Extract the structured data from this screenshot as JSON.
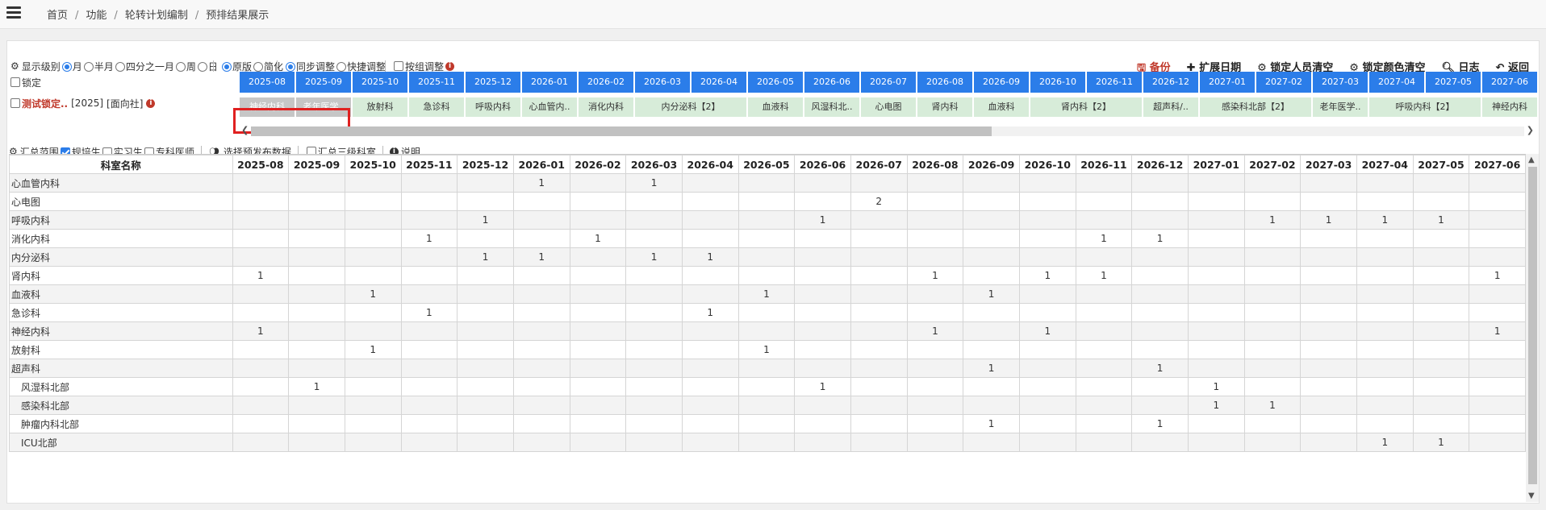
{
  "breadcrumb": [
    "首页",
    "功能",
    "轮转计划编制",
    "预排结果展示"
  ],
  "toolbar": {
    "display_level_label": "显示级别",
    "level_options": [
      {
        "label": "月",
        "selected": true
      },
      {
        "label": "半月",
        "selected": false
      },
      {
        "label": "四分之一月",
        "selected": false
      },
      {
        "label": "周",
        "selected": false
      },
      {
        "label": "日",
        "selected": false
      }
    ],
    "version_options": [
      {
        "label": "原版",
        "selected": true
      },
      {
        "label": "简化",
        "selected": false
      }
    ],
    "adjust_options": [
      {
        "label": "同步调整",
        "selected": true
      },
      {
        "label": "快捷调整",
        "selected": false
      }
    ],
    "group_adjust_label": "按组调整",
    "actions": {
      "backup": "备份",
      "extend_date": "扩展日期",
      "clear_locked_people": "锁定人员清空",
      "clear_locked_colors": "锁定颜色清空",
      "log": "日志",
      "back": "返回"
    }
  },
  "lock": {
    "lock_label": "锁定",
    "person_label": "测试锁定..",
    "person_year": "[2025]",
    "person_tag": "[面向社]"
  },
  "months": [
    "2025-08",
    "2025-09",
    "2025-10",
    "2025-11",
    "2025-12",
    "2026-01",
    "2026-02",
    "2026-03",
    "2026-04",
    "2026-05",
    "2026-06",
    "2026-07",
    "2026-08",
    "2026-09",
    "2026-10",
    "2026-11",
    "2026-12",
    "2027-01",
    "2027-02",
    "2027-03",
    "2027-04",
    "2027-05",
    "2027-06"
  ],
  "assignments": [
    {
      "label": "神经内科",
      "span": 1,
      "locked": true
    },
    {
      "label": "老年医学..",
      "span": 1,
      "locked": true
    },
    {
      "label": "放射科",
      "span": 1,
      "locked": false
    },
    {
      "label": "急诊科",
      "span": 1,
      "locked": false
    },
    {
      "label": "呼吸内科",
      "span": 1,
      "locked": false
    },
    {
      "label": "心血管内..",
      "span": 1,
      "locked": false
    },
    {
      "label": "消化内科",
      "span": 1,
      "locked": false
    },
    {
      "label": "内分泌科【2】",
      "span": 2,
      "locked": false
    },
    {
      "label": "血液科",
      "span": 1,
      "locked": false
    },
    {
      "label": "风湿科北..",
      "span": 1,
      "locked": false
    },
    {
      "label": "心电图",
      "span": 1,
      "locked": false
    },
    {
      "label": "肾内科",
      "span": 1,
      "locked": false
    },
    {
      "label": "血液科",
      "span": 1,
      "locked": false
    },
    {
      "label": "肾内科【2】",
      "span": 2,
      "locked": false
    },
    {
      "label": "超声科/..",
      "span": 1,
      "locked": false
    },
    {
      "label": "感染科北部【2】",
      "span": 2,
      "locked": false
    },
    {
      "label": "老年医学..",
      "span": 1,
      "locked": false
    },
    {
      "label": "呼吸内科【2】",
      "span": 2,
      "locked": false
    },
    {
      "label": "神经内科",
      "span": 1,
      "locked": false
    }
  ],
  "summary": {
    "range_label": "汇总范围",
    "options": [
      {
        "label": "规培生",
        "checked": true
      },
      {
        "label": "实习生",
        "checked": false
      },
      {
        "label": "专科医师",
        "checked": false
      }
    ],
    "select_publish": "选择预发布数据",
    "level3_label": "汇总三级科室",
    "explain": "说明"
  },
  "table": {
    "header_name": "科室名称",
    "rows": [
      {
        "name": "心血管内科",
        "indent": false,
        "values": [
          "",
          "",
          "",
          "",
          "",
          "1",
          "",
          "1",
          "",
          "",
          "",
          "",
          "",
          "",
          "",
          "",
          "",
          "",
          "",
          "",
          "",
          "",
          ""
        ]
      },
      {
        "name": "心电图",
        "indent": false,
        "values": [
          "",
          "",
          "",
          "",
          "",
          "",
          "",
          "",
          "",
          "",
          "",
          "2",
          "",
          "",
          "",
          "",
          "",
          "",
          "",
          "",
          "",
          "",
          ""
        ]
      },
      {
        "name": "呼吸内科",
        "indent": false,
        "values": [
          "",
          "",
          "",
          "",
          "1",
          "",
          "",
          "",
          "",
          "",
          "1",
          "",
          "",
          "",
          "",
          "",
          "",
          "",
          "1",
          "1",
          "1",
          "1",
          ""
        ]
      },
      {
        "name": "消化内科",
        "indent": false,
        "values": [
          "",
          "",
          "",
          "1",
          "",
          "",
          "1",
          "",
          "",
          "",
          "",
          "",
          "",
          "",
          "",
          "1",
          "1",
          "",
          "",
          "",
          "",
          "",
          ""
        ]
      },
      {
        "name": "内分泌科",
        "indent": false,
        "values": [
          "",
          "",
          "",
          "",
          "1",
          "1",
          "",
          "1",
          "1",
          "",
          "",
          "",
          "",
          "",
          "",
          "",
          "",
          "",
          "",
          "",
          "",
          "",
          ""
        ]
      },
      {
        "name": "肾内科",
        "indent": false,
        "values": [
          "1",
          "",
          "",
          "",
          "",
          "",
          "",
          "",
          "",
          "",
          "",
          "",
          "1",
          "",
          "1",
          "1",
          "",
          "",
          "",
          "",
          "",
          "",
          "1"
        ]
      },
      {
        "name": "血液科",
        "indent": false,
        "values": [
          "",
          "",
          "1",
          "",
          "",
          "",
          "",
          "",
          "",
          "1",
          "",
          "",
          "",
          "1",
          "",
          "",
          "",
          "",
          "",
          "",
          "",
          "",
          ""
        ]
      },
      {
        "name": "急诊科",
        "indent": false,
        "values": [
          "",
          "",
          "",
          "1",
          "",
          "",
          "",
          "",
          "1",
          "",
          "",
          "",
          "",
          "",
          "",
          "",
          "",
          "",
          "",
          "",
          "",
          "",
          ""
        ]
      },
      {
        "name": "神经内科",
        "indent": false,
        "values": [
          "1",
          "",
          "",
          "",
          "",
          "",
          "",
          "",
          "",
          "",
          "",
          "",
          "1",
          "",
          "1",
          "",
          "",
          "",
          "",
          "",
          "",
          "",
          "1"
        ]
      },
      {
        "name": "放射科",
        "indent": false,
        "values": [
          "",
          "",
          "1",
          "",
          "",
          "",
          "",
          "",
          "",
          "1",
          "",
          "",
          "",
          "",
          "",
          "",
          "",
          "",
          "",
          "",
          "",
          "",
          ""
        ]
      },
      {
        "name": "超声科",
        "indent": false,
        "values": [
          "",
          "",
          "",
          "",
          "",
          "",
          "",
          "",
          "",
          "",
          "",
          "",
          "",
          "1",
          "",
          "",
          "1",
          "",
          "",
          "",
          "",
          "",
          ""
        ]
      },
      {
        "name": "风湿科北部",
        "indent": true,
        "values": [
          "",
          "1",
          "",
          "",
          "",
          "",
          "",
          "",
          "",
          "",
          "1",
          "",
          "",
          "",
          "",
          "",
          "",
          "1",
          "",
          "",
          "",
          "",
          ""
        ]
      },
      {
        "name": "感染科北部",
        "indent": true,
        "values": [
          "",
          "",
          "",
          "",
          "",
          "",
          "",
          "",
          "",
          "",
          "",
          "",
          "",
          "",
          "",
          "",
          "",
          "1",
          "1",
          "",
          "",
          "",
          ""
        ]
      },
      {
        "name": "肿瘤内科北部",
        "indent": true,
        "values": [
          "",
          "",
          "",
          "",
          "",
          "",
          "",
          "",
          "",
          "",
          "",
          "",
          "",
          "1",
          "",
          "",
          "1",
          "",
          "",
          "",
          "",
          "",
          ""
        ]
      },
      {
        "name": "ICU北部",
        "indent": true,
        "values": [
          "",
          "",
          "",
          "",
          "",
          "",
          "",
          "",
          "",
          "",
          "",
          "",
          "",
          "",
          "",
          "",
          "",
          "",
          "",
          "",
          "1",
          "1",
          ""
        ]
      }
    ]
  },
  "colors": {
    "accent": "#2b7de9",
    "assigned": "#d7ecd9",
    "locked": "#c6c6c6",
    "highlight": "#e02020",
    "danger": "#c0392b"
  }
}
